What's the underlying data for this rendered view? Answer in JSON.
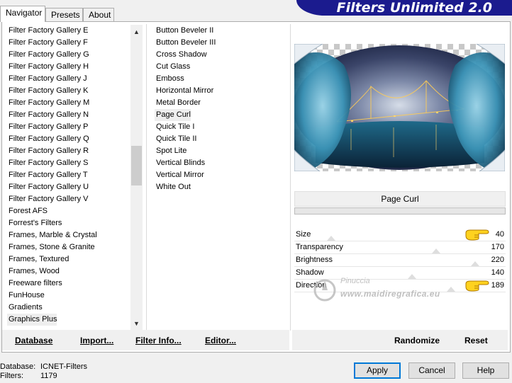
{
  "banner_title": "Filters Unlimited 2.0",
  "tabs": [
    {
      "label": "Navigator",
      "active": true
    },
    {
      "label": "Presets",
      "active": false
    },
    {
      "label": "About",
      "active": false
    }
  ],
  "categories": [
    "Filter Factory Gallery E",
    "Filter Factory Gallery F",
    "Filter Factory Gallery G",
    "Filter Factory Gallery H",
    "Filter Factory Gallery J",
    "Filter Factory Gallery K",
    "Filter Factory Gallery M",
    "Filter Factory Gallery N",
    "Filter Factory Gallery P",
    "Filter Factory Gallery Q",
    "Filter Factory Gallery R",
    "Filter Factory Gallery S",
    "Filter Factory Gallery T",
    "Filter Factory Gallery U",
    "Filter Factory Gallery V",
    "Forest AFS",
    "Forrest's Filters",
    "Frames, Marble & Crystal",
    "Frames, Stone & Granite",
    "Frames, Textured",
    "Frames, Wood",
    "Freeware filters",
    "FunHouse",
    "Gradients",
    "Graphics Plus"
  ],
  "selected_category": "Graphics Plus",
  "filters": [
    "Button Beveler II",
    "Button Beveler III",
    "Cross Shadow",
    "Cut Glass",
    "Emboss",
    "Horizontal Mirror",
    "Metal Border",
    "Page Curl",
    "Quick Tile I",
    "Quick Tile II",
    "Spot Lite",
    "Vertical Blinds",
    "Vertical Mirror",
    "White Out"
  ],
  "selected_filter": "Page Curl",
  "filter_title": "Page Curl",
  "params": [
    {
      "label": "Size",
      "value": "40",
      "pointer": true
    },
    {
      "label": "Transparency",
      "value": "170",
      "pointer": false
    },
    {
      "label": "Brightness",
      "value": "220",
      "pointer": false
    },
    {
      "label": "Shadow",
      "value": "140",
      "pointer": false
    },
    {
      "label": "Direction",
      "value": "189",
      "pointer": true
    }
  ],
  "param_levels": [
    0.16,
    0.67,
    0.86,
    0.55,
    0.74
  ],
  "watermark": {
    "line1": "Pinuccia",
    "line2": "www.maidiregrafica.eu"
  },
  "toolbar": {
    "database": "Database",
    "import": "Import...",
    "filter_info": "Filter Info...",
    "editor": "Editor...",
    "randomize": "Randomize",
    "reset": "Reset"
  },
  "status": {
    "database_label": "Database:",
    "database_value": "ICNET-Filters",
    "filters_label": "Filters:",
    "filters_value": "1179"
  },
  "buttons": {
    "apply": "Apply",
    "cancel": "Cancel",
    "help": "Help"
  },
  "colors": {
    "banner": "#1b1b8e",
    "accent": "#0078d7"
  }
}
